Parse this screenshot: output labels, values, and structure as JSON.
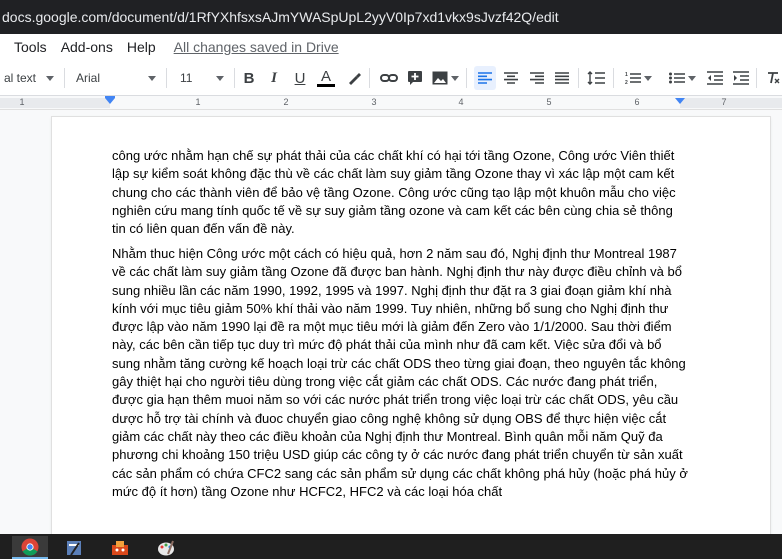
{
  "browser": {
    "url": "docs.google.com/document/d/1RfYXhfsxsAJmYWASpUpL2yyV0Ip7xd1vkx9sJvzf42Q/edit"
  },
  "menu": {
    "items": [
      "Tools",
      "Add-ons",
      "Help"
    ],
    "saved_status": "All changes saved in Drive"
  },
  "toolbar": {
    "style": "al text",
    "font": "Arial",
    "size": "11",
    "bold": "B",
    "italic": "I",
    "underline": "U",
    "text_color_label": "A",
    "accent_color": "#1a73e8"
  },
  "ruler": {
    "numbers": [
      "1",
      "1",
      "2",
      "3",
      "4",
      "5",
      "6",
      "7"
    ]
  },
  "document": {
    "paragraphs": [
      "công ước nhằm hạn chế sự phát thải của các chất khí có hại tới tầng Ozone, Công ước Viên thiết lập sự kiểm soát không đặc thù về các chất làm suy giảm tầng Ozone thay vì xác lập một cam kết chung cho các thành viên để bảo vệ tầng Ozone. Công ước cũng tạo lập một khuôn mẫu cho việc nghiên cứu mang tính quốc tế về sự suy giảm tầng ozone và cam kết các bên cùng chia sẻ thông tin có liên quan đến vấn đề này.",
      "Nhằm thuc hiện Công ước một cách có hiệu quả, hơn 2 năm sau đó, Nghị định thư Montreal 1987 về các chất làm suy giảm tầng Ozone đã được ban hành. Nghị định thư này được điều chỉnh và bổ sung nhiều lần các năm 1990, 1992, 1995 và 1997. Nghị định thư đặt ra 3 giai đoạn giảm khí nhà kính với mục tiêu giảm 50% khí thải vào năm 1999. Tuy nhiên, những bổ sung cho Nghị định thư được lập vào năm 1990 lại đề ra một mục tiêu mới là giảm đến Zero vào 1/1/2000. Sau thời điểm này, các bên cần tiếp tục duy trì mức độ phát thải của mình như đã cam kết. Việc sửa đổi và bổ sung nhằm tăng cường kế hoạch loại trừ các chất ODS theo từng giai đoạn, theo nguyên tắc không gây thiệt hại cho người tiêu dùng trong việc cắt giảm các chất ODS. Các nước đang phát triển, được gia hạn thêm muoi năm so với các nước phát triển trong việc loại trừ các chất ODS, yêu cầu dược hỗ trợ tài chính và đuoc chuyển giao công nghệ không sử dụng OBS để thực hiện việc cắt giảm các chất này theo các điều khoản của Nghị định thư Montreal. Bình quân mỗi năm Quỹ đa phương chi khoảng 150 triệu USD giúp các công ty ở các nước đang phát triển chuyển từ sản xuất các sản phẩm có chứa CFC2 sang các sản phẩm sử dụng các chất không phá hủy (hoặc phá hủy ở mức độ ít hơn) tầng Ozone như HCFC2, HFC2 và các loại hóa chất"
    ]
  },
  "taskbar": {
    "apps": [
      "chrome",
      "word-pad",
      "game",
      "paint"
    ]
  }
}
